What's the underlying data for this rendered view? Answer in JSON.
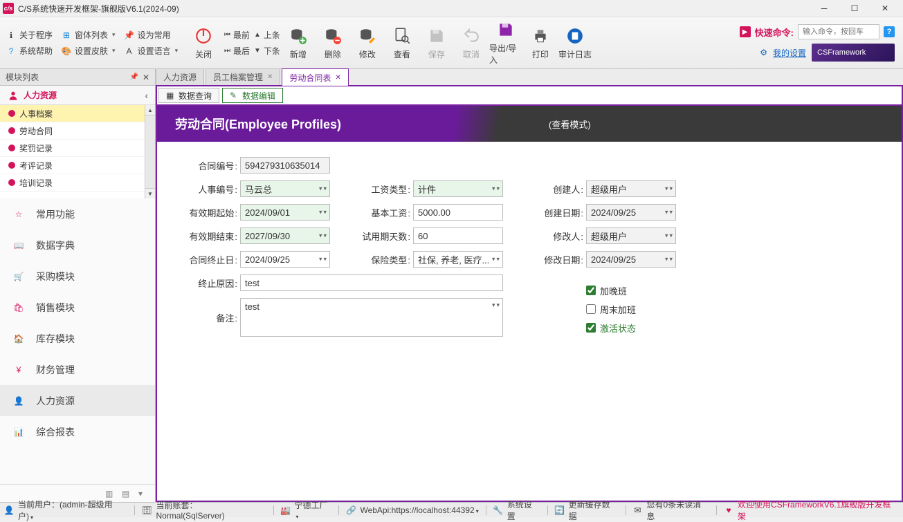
{
  "window": {
    "title": "C/S系统快速开发框架-旗舰版V6.1(2024-09)"
  },
  "menu": {
    "about": "关于程序",
    "formList": "窗体列表",
    "setCommon": "设为常用",
    "sysHelp": "系统帮助",
    "setSkin": "设置皮肤",
    "setLang": "设置语言"
  },
  "toolbar": {
    "close": "关闭",
    "first": "最前",
    "last": "最后",
    "prev": "上条",
    "next": "下条",
    "add": "新增",
    "delete": "删除",
    "modify": "修改",
    "view": "查看",
    "save": "保存",
    "cancel": "取消",
    "export": "导出/导入",
    "print": "打印",
    "audit": "审计日志"
  },
  "quickCmd": {
    "label": "快速命令:",
    "placeholder": "输入命令，按回车",
    "settings": "我的设置",
    "banner": "CSFramework"
  },
  "sidebar": {
    "header": "模块列表",
    "catTitle": "人力资源",
    "items": [
      "人事档案",
      "劳动合同",
      "奖罚记录",
      "考评记录",
      "培训记录"
    ],
    "activeIndex": 0,
    "modules": [
      "常用功能",
      "数据字典",
      "采购模块",
      "销售模块",
      "库存模块",
      "财务管理",
      "人力资源",
      "综合报表"
    ],
    "activeModule": 6
  },
  "tabs": {
    "items": [
      "人力资源",
      "员工档案管理",
      "劳动合同表"
    ],
    "closeable": [
      false,
      true,
      true
    ],
    "activeIndex": 2
  },
  "subtabs": {
    "items": [
      "数据查询",
      "数据编辑"
    ],
    "activeIndex": 1
  },
  "banner": {
    "title": "劳动合同(Employee Profiles)",
    "mode": "(查看模式)"
  },
  "form": {
    "contractNo": {
      "label": "合同编号",
      "value": "594279310635014"
    },
    "personNo": {
      "label": "人事编号",
      "value": "马云总"
    },
    "salaryType": {
      "label": "工资类型",
      "value": "计件"
    },
    "creator": {
      "label": "创建人",
      "value": "超级用户"
    },
    "startDate": {
      "label": "有效期起始",
      "value": "2024/09/01"
    },
    "baseSalary": {
      "label": "基本工资",
      "value": "5000.00"
    },
    "createDate": {
      "label": "创建日期",
      "value": "2024/09/25"
    },
    "endDate": {
      "label": "有效期结束",
      "value": "2027/09/30"
    },
    "trialDays": {
      "label": "试用期天数",
      "value": "60"
    },
    "modifier": {
      "label": "修改人",
      "value": "超级用户"
    },
    "termDate": {
      "label": "合同终止日",
      "value": "2024/09/25"
    },
    "insurance": {
      "label": "保险类型",
      "value": "社保, 养老, 医疗..."
    },
    "modifyDate": {
      "label": "修改日期",
      "value": "2024/09/25"
    },
    "termReason": {
      "label": "终止原因",
      "value": "test"
    },
    "remark": {
      "label": "备注",
      "value": "test"
    },
    "overtime": {
      "label": "加晚班",
      "checked": true
    },
    "weekendOT": {
      "label": "周末加班",
      "checked": false
    },
    "active": {
      "label": "激活状态",
      "checked": true
    }
  },
  "status": {
    "user": "当前用户：(admin-超级用户)",
    "account": "当前账套：Normal(SqlServer)",
    "factory": "宁德工厂",
    "webapi": "WebApi:https://localhost:44392",
    "sysSetting": "系统设置",
    "refresh": "更新缓存数据",
    "mail": "您有0条未读消息",
    "welcome": "欢迎使用CSFrameworkV6.1旗舰版开发框架"
  }
}
